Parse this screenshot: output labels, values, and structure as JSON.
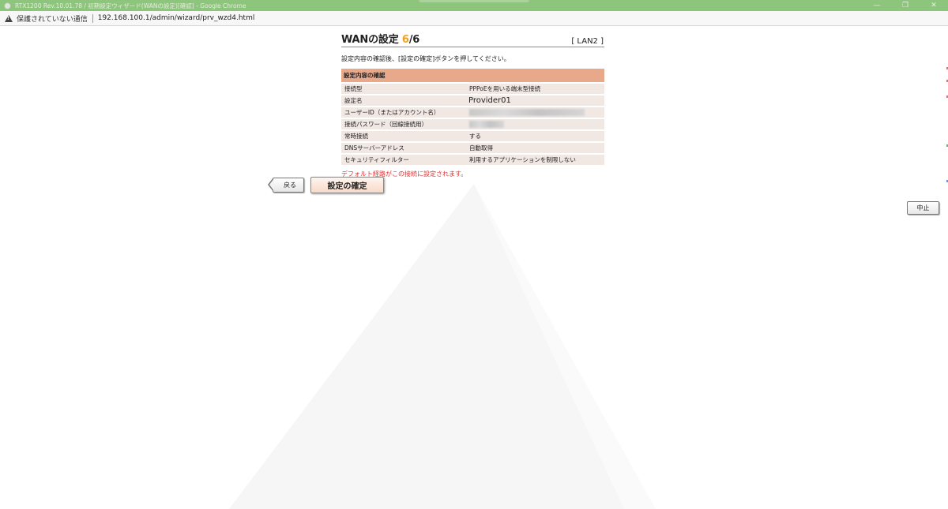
{
  "window": {
    "title": "RTX1200 Rev.10.01.78 / 初期設定ウィザード(WANの設定)[確認] - Google Chrome",
    "controls": {
      "minimize": "—",
      "restore": "❐",
      "close": "✕"
    }
  },
  "addressbar": {
    "security_label": "保護されていない通信",
    "url": "192.168.100.1/admin/wizard/prv_wzd4.html",
    "icon": "warning-icon"
  },
  "page": {
    "heading": {
      "title_prefix": "WANの設定 ",
      "step_current": "6",
      "step_total": "/6",
      "lan_label": "[ LAN2 ]"
    },
    "instruction": "設定内容の確認後、[設定の確定]ボタンを押してください。",
    "table": {
      "header": "設定内容の確認",
      "rows": [
        {
          "label": "接続型",
          "value": "PPPoEを用いる端末型接続"
        },
        {
          "label": "設定名",
          "value": "Provider01"
        },
        {
          "label": "ユーザーID（またはアカウント名）",
          "value": ""
        },
        {
          "label": "接続パスワード（回線接続用）",
          "value": ""
        },
        {
          "label": "常時接続",
          "value": "する"
        },
        {
          "label": "DNSサーバーアドレス",
          "value": "自動取得"
        },
        {
          "label": "セキュリティフィルター",
          "value": "利用するアプリケーションを制限しない"
        }
      ]
    },
    "note": "デフォルト経路がこの接続に設定されます。",
    "buttons": {
      "back": "戻る",
      "confirm": "設定の確定",
      "cancel": "中止"
    }
  }
}
